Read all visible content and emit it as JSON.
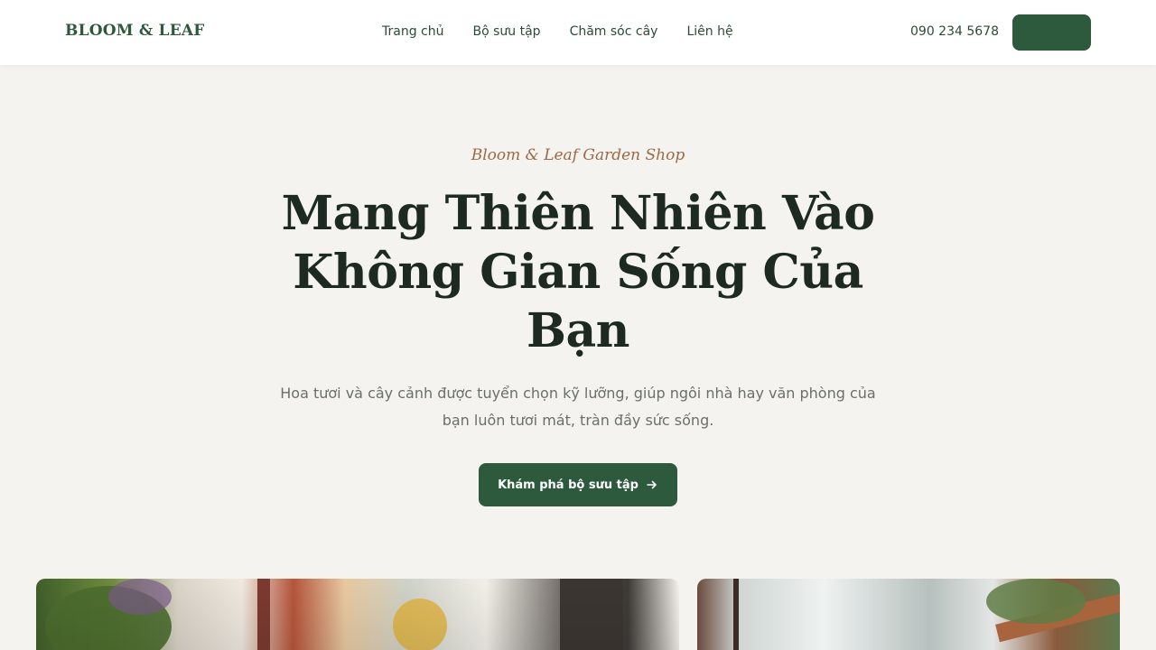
{
  "brand": {
    "logo": "BLOOM & LEAF"
  },
  "nav": {
    "items": [
      {
        "label": "Trang chủ"
      },
      {
        "label": "Bộ sưu tập"
      },
      {
        "label": "Chăm sóc cây"
      },
      {
        "label": "Liên hệ"
      }
    ]
  },
  "header": {
    "phone": "090 234 5678",
    "cta_label": ""
  },
  "hero": {
    "tagline": "Bloom & Leaf Garden Shop",
    "headline": "Mang Thiên Nhiên Vào Không Gian Sống Của Bạn",
    "subtitle": "Hoa tươi và cây cảnh được tuyển chọn kỹ lưỡng, giúp ngôi nhà hay văn phòng của bạn luôn tươi mát, tràn đầy sức sống.",
    "cta_label": "Khám phá bộ sưu tập",
    "cta_icon": "arrow-right-icon"
  },
  "colors": {
    "brand_green": "#2d5a3d",
    "accent_brown": "#9a6a45",
    "background": "#f4f3ef"
  }
}
